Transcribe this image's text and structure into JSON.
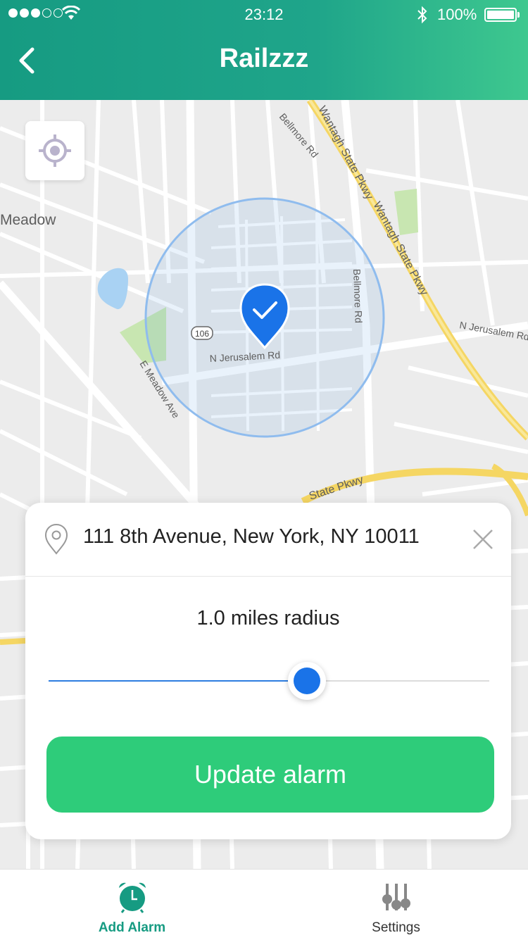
{
  "status_bar": {
    "time": "23:12",
    "battery_percent": "100%",
    "signal_bars_filled": 3,
    "signal_bars_total": 5
  },
  "header": {
    "title": "Railzzz",
    "back_icon": "chevron-left-icon"
  },
  "map": {
    "labels": [
      "Meadow",
      "Bellmore Rd",
      "Wantagh State Pkwy",
      "Wantagh State Pkwy",
      "Bellmore Rd",
      "N Jerusalem Rd",
      "N Jerusalem Rd",
      "E Meadow Ave",
      "106",
      "State Pkwy"
    ],
    "locate_icon": "crosshair-icon",
    "marker_icon": "check-pin-icon"
  },
  "card": {
    "address": "111 8th Avenue, New York, NY 10011",
    "radius_label": "1.0 miles radius",
    "slider_value_fraction": 0.587,
    "button_label": "Update alarm"
  },
  "tabbar": {
    "items": [
      {
        "label": "Add Alarm",
        "icon": "alarm-clock-icon",
        "active": true
      },
      {
        "label": "Settings",
        "icon": "sliders-icon",
        "active": false
      }
    ]
  },
  "colors": {
    "header": "#1fa58a",
    "accent": "#2ecc7a",
    "primary_blue": "#1a73e8",
    "tab_active": "#169b82"
  }
}
